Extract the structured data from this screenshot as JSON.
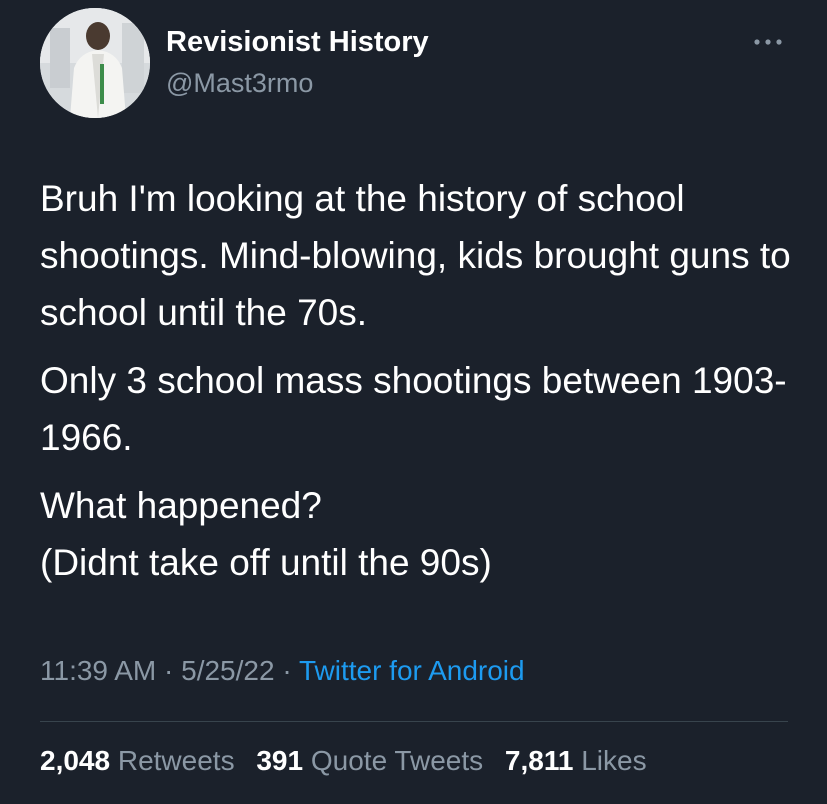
{
  "author": {
    "name": "Revisionist History",
    "handle": "@Mast3rmo"
  },
  "tweet": {
    "paragraphs": [
      "Bruh I'm looking at the history of school shootings. Mind-blowing, kids brought guns to school until the 70s.",
      "Only 3 school mass shootings between 1903-1966.",
      "What happened?\n(Didnt take off until the 90s)"
    ]
  },
  "meta": {
    "time": "11:39 AM",
    "date": "5/25/22",
    "separator": "·",
    "source": "Twitter for Android"
  },
  "stats": {
    "retweets_count": "2,048",
    "retweets_label": "Retweets",
    "quotes_count": "391",
    "quotes_label": "Quote Tweets",
    "likes_count": "7,811",
    "likes_label": "Likes"
  },
  "icons": {
    "more": "more-horizontal-icon"
  },
  "colors": {
    "background": "#1b212b",
    "text": "#ffffff",
    "secondary": "#8b98a5",
    "link": "#1d9bf0",
    "divider": "#38444d"
  }
}
